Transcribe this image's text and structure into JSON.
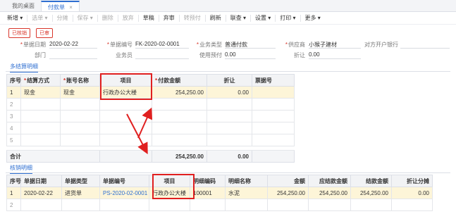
{
  "tabs": [
    {
      "label": "我的桌面"
    },
    {
      "label": "付款单"
    }
  ],
  "toolbar": {
    "new": "新增",
    "select": "选单",
    "split": "分摊",
    "save": "保存",
    "delete": "删除",
    "discard": "放弃",
    "draft": "草稿",
    "audit_reject": "弃审",
    "transfer": "转预付",
    "refresh": "刷新",
    "query": "联查",
    "settings": "设置",
    "print": "打印",
    "more": "更多"
  },
  "status": {
    "checked": "已核销",
    "audited": "已审"
  },
  "form": {
    "date_label": "单据日期",
    "date_value": "2020-02-22",
    "code_label": "单据编号",
    "code_value": "FK-2020-02-0001",
    "biz_type_label": "业务类型",
    "biz_type_value": "普通付款",
    "supplier_label": "供应商",
    "supplier_value": "小猴子建材",
    "bank_label": "对方开户银行",
    "bank_value": "",
    "dept_label": "部门",
    "dept_value": "",
    "staff_label": "业务员",
    "staff_value": "",
    "prepay_label": "使用预付",
    "prepay_value": "0.00",
    "discount_label": "折让",
    "discount_value": "0.00"
  },
  "multi_settle": {
    "title": "多结算明细",
    "headers": [
      "序号",
      "结算方式",
      "账号名称",
      "项目",
      "付款金额",
      "折让",
      "票据号"
    ],
    "rows": [
      [
        "1",
        "现金",
        "现金",
        "行政办公大楼",
        "254,250.00",
        "0.00",
        ""
      ],
      [
        "2",
        "",
        "",
        "",
        "",
        "",
        ""
      ],
      [
        "3",
        "",
        "",
        "",
        "",
        "",
        ""
      ],
      [
        "4",
        "",
        "",
        "",
        "",
        "",
        ""
      ],
      [
        "5",
        "",
        "",
        "",
        "",
        "",
        ""
      ]
    ],
    "total_label": "合计",
    "total_amount": "254,250.00",
    "total_discount": "0.00"
  },
  "writeoff": {
    "title": "核销明细",
    "headers": [
      "序号",
      "单据日期",
      "单据类型",
      "单据编号",
      "项目",
      "明细编码",
      "明细名称",
      "金额",
      "应结款金额",
      "结款金额",
      "折让分摊"
    ],
    "rows": [
      [
        "1",
        "2020-02-22",
        "进货单",
        "PS-2020-02-0001",
        "行政办公大楼",
        "100001",
        "水泥",
        "254,250.00",
        "254,250.00",
        "254,250.00",
        "0.00"
      ],
      [
        "2",
        "",
        "",
        "",
        "",
        "",
        "",
        "",
        "",
        "",
        ""
      ]
    ]
  },
  "colors": {
    "accent": "#2f6fd1",
    "highlight_box": "#e02020",
    "selected_row": "#fdf5d8"
  }
}
